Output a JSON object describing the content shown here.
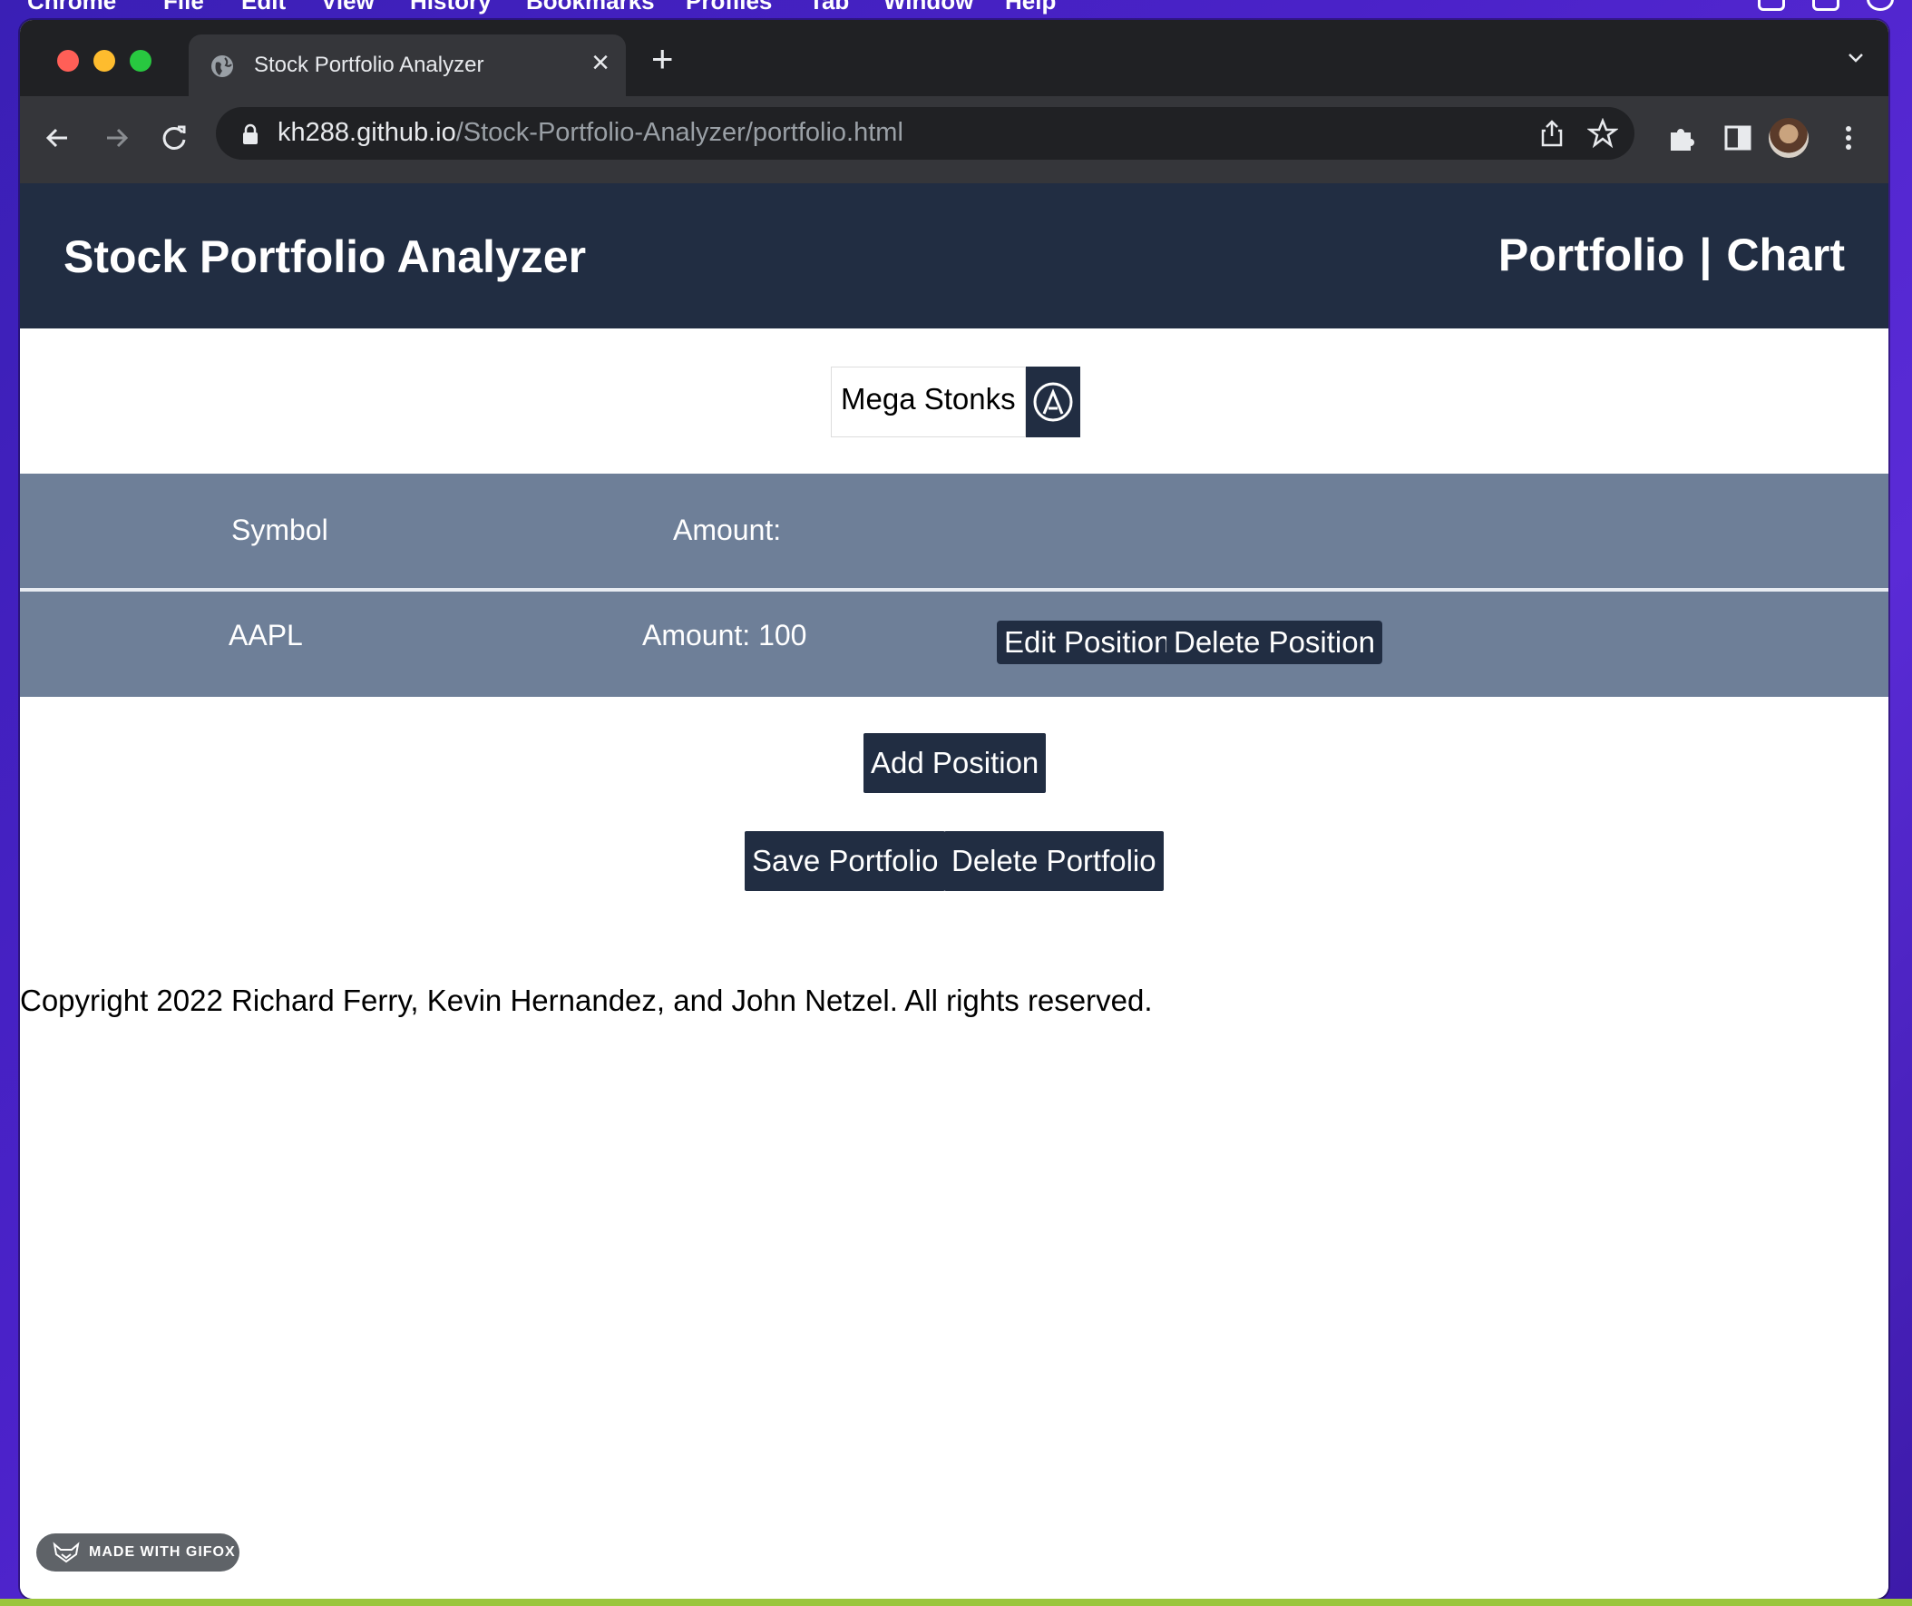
{
  "menubar": {
    "items": [
      "Chrome",
      "File",
      "Edit",
      "View",
      "History",
      "Bookmarks",
      "Profiles",
      "Tab",
      "Window",
      "Help"
    ]
  },
  "browser": {
    "tab_title": "Stock Portfolio Analyzer",
    "url_host": "kh288.github.io",
    "url_path": "/Stock-Portfolio-Analyzer/portfolio.html"
  },
  "header": {
    "title": "Stock Portfolio Analyzer",
    "nav": [
      "Portfolio",
      "|",
      "Chart"
    ]
  },
  "portfolio": {
    "name": "Mega Stonks"
  },
  "table": {
    "headers": [
      "Symbol",
      "Amount:"
    ],
    "rows": [
      {
        "symbol": "AAPL",
        "amount": "Amount: 100",
        "edit_label": "Edit Position",
        "delete_label": "Delete Position"
      }
    ]
  },
  "actions": {
    "add_position": "Add Position",
    "save_portfolio": "Save Portfolio",
    "delete_portfolio": "Delete Portfolio"
  },
  "footer": {
    "copyright": "Copyright 2022 Richard Ferry, Kevin Hernandez, and John Netzel. All rights reserved."
  },
  "badge": {
    "label": "MADE WITH GIFOX"
  },
  "colors": {
    "header_bg": "#212d42",
    "table_bg": "#6e7f98",
    "button_bg": "#212d42"
  }
}
